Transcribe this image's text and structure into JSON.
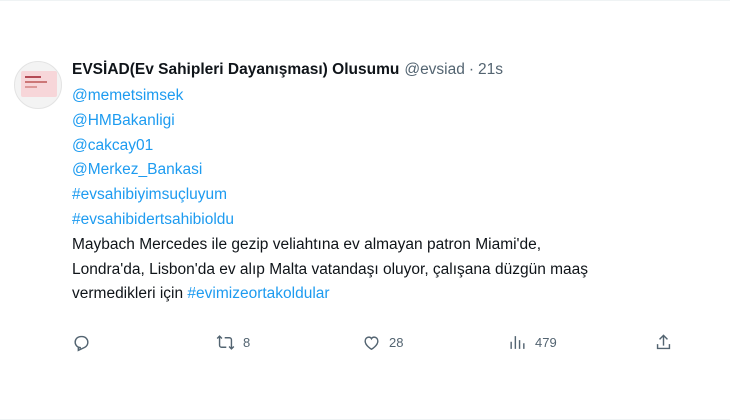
{
  "tweet": {
    "display_name": "EVSİAD(Ev Sahipleri Dayanışması) Olusumu",
    "handle": "@evsiad",
    "separator": "·",
    "time": "21s",
    "lines": [
      {
        "type": "mention",
        "text": "@memetsimsek"
      },
      {
        "type": "mention",
        "text": "@HMBakanligi"
      },
      {
        "type": "mention",
        "text": "@cakcay01"
      },
      {
        "type": "mention",
        "text": "@Merkez_Bankasi"
      },
      {
        "type": "hashtag",
        "text": "#evsahibiyimsuçluyum"
      },
      {
        "type": "hashtag",
        "text": "#evsahibidertsahibioldu"
      }
    ],
    "text_line1": "Maybach Mercedes ile gezip veliahtına ev almayan patron Miami'de,",
    "text_line2": "Londra'da, Lisbon'da ev alıp Malta vatandaşı oluyor, çalışana düzgün maaş",
    "text_line3_prefix": "vermedikleri için ",
    "text_line3_hashtag": "#evimizeortakoldular"
  },
  "actions": {
    "reply": {
      "icon": "reply-icon",
      "count": ""
    },
    "retweet": {
      "icon": "retweet-icon",
      "count": "8"
    },
    "like": {
      "icon": "heart-icon",
      "count": "28"
    },
    "views": {
      "icon": "views-icon",
      "count": "479"
    },
    "share": {
      "icon": "share-icon",
      "count": ""
    }
  },
  "colors": {
    "link": "#1d9bf0",
    "text": "#0f1419",
    "muted": "#536471"
  }
}
